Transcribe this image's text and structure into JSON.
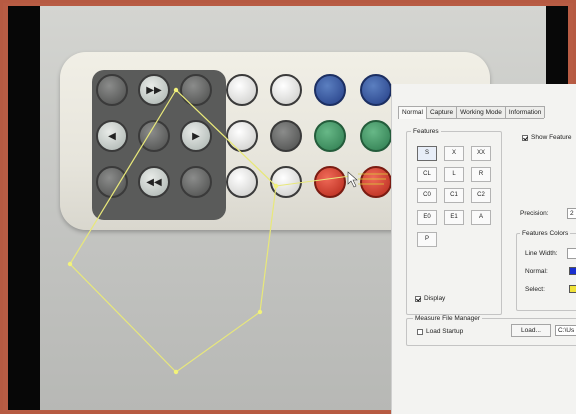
{
  "tabs": [
    "Normal",
    "Capture",
    "Working Mode",
    "Information"
  ],
  "features": {
    "title": "Features",
    "buttons": [
      [
        "S",
        "X",
        "XX"
      ],
      [
        "CL",
        "L",
        "R"
      ],
      [
        "C0",
        "C1",
        "C2"
      ],
      [
        "E0",
        "E1",
        "A"
      ],
      [
        "P"
      ]
    ],
    "selected": "S"
  },
  "show_features": "Show Feature",
  "precision": {
    "label": "Precision:",
    "value": "2"
  },
  "features_colors": {
    "title": "Features Colors",
    "line_width": "Line Width:",
    "normal": "Normal:",
    "select": "Select:",
    "normal_color": "#1a2fd0",
    "select_color": "#f0e23a"
  },
  "display": {
    "label": "Display",
    "checked": true
  },
  "measure_file_manager": {
    "title": "Measure File Manager",
    "load_startup": "Load Startup",
    "load_button": "Load...",
    "path": "C:\\Us"
  },
  "camera": {
    "overlay_color": "#e8e87a",
    "cursor_color": "#d8d23a"
  }
}
